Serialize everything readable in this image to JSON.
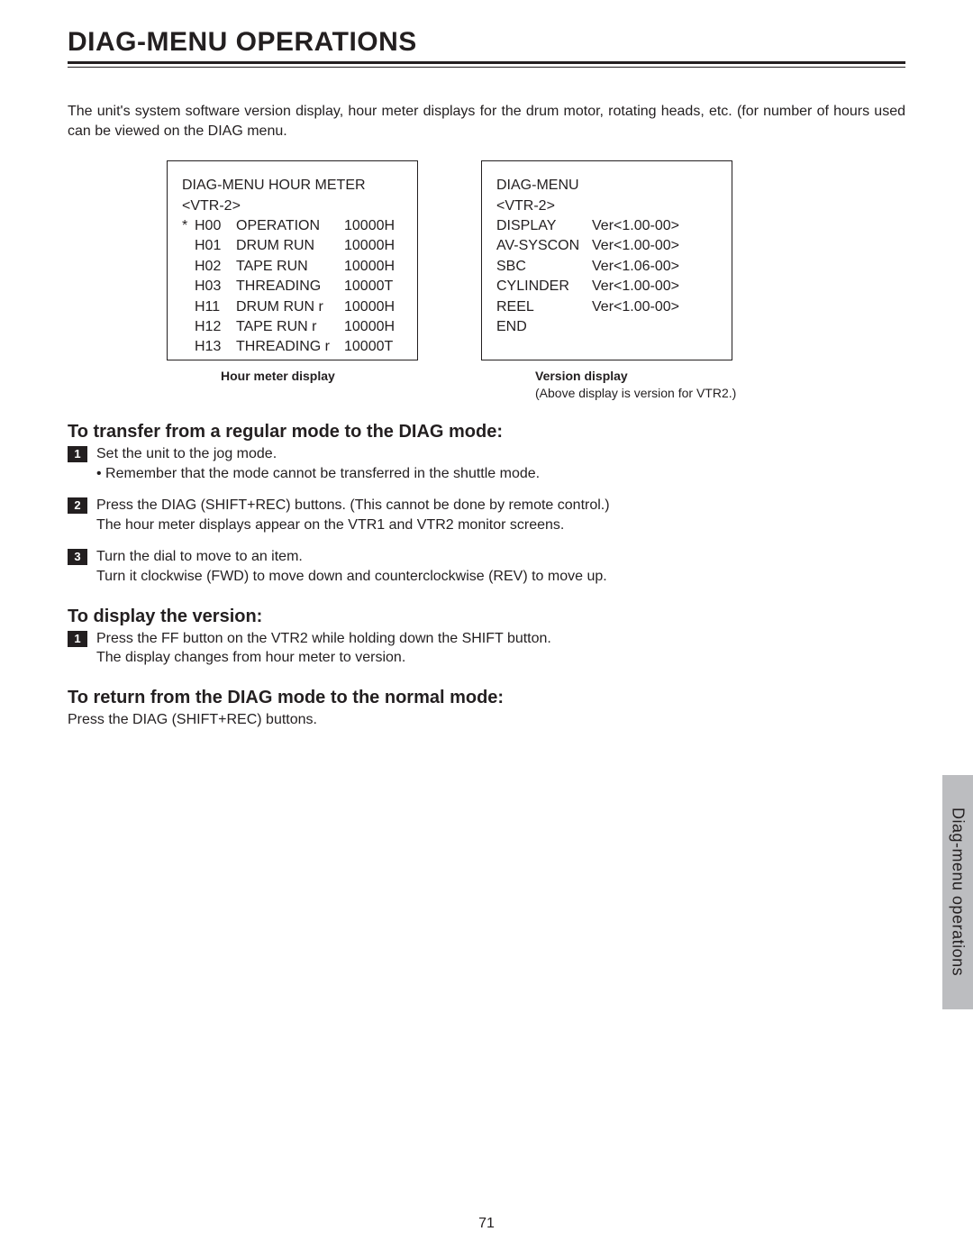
{
  "title": "DIAG-MENU OPERATIONS",
  "intro": "The unit's system software version display, hour meter displays for the drum motor, rotating heads, etc. (for number of hours used can be viewed on the DIAG menu.",
  "hour_meter": {
    "header1": "DIAG-MENU HOUR METER",
    "header2": "<VTR-2>",
    "rows": [
      {
        "mark": "*",
        "code": "H00",
        "name": "OPERATION",
        "val": "10000H"
      },
      {
        "mark": "",
        "code": "H01",
        "name": "DRUM RUN",
        "val": "10000H"
      },
      {
        "mark": "",
        "code": "H02",
        "name": "TAPE RUN",
        "val": "10000H"
      },
      {
        "mark": "",
        "code": "H03",
        "name": "THREADING",
        "val": "10000T"
      },
      {
        "mark": "",
        "code": "H11",
        "name": "DRUM RUN r",
        "val": "10000H"
      },
      {
        "mark": "",
        "code": "H12",
        "name": "TAPE RUN r",
        "val": "10000H"
      },
      {
        "mark": "",
        "code": "H13",
        "name": "THREADING r",
        "val": "10000T"
      }
    ],
    "caption_bold": "Hour meter display"
  },
  "version": {
    "header1": "DIAG-MENU",
    "header2": "<VTR-2>",
    "rows": [
      {
        "name": "DISPLAY",
        "val": "Ver<1.00-00>"
      },
      {
        "name": "AV-SYSCON",
        "val": "Ver<1.00-00>"
      },
      {
        "name": "SBC",
        "val": "Ver<1.06-00>"
      },
      {
        "name": "CYLINDER",
        "val": "Ver<1.00-00>"
      },
      {
        "name": "REEL",
        "val": "Ver<1.00-00>"
      },
      {
        "name": "END",
        "val": ""
      }
    ],
    "caption_bold": "Version display",
    "caption_note": "(Above display is version for VTR2.)"
  },
  "sections": {
    "s1": {
      "heading": "To transfer from a regular mode to the DIAG mode:",
      "steps": [
        {
          "num": "1",
          "lines": [
            "Set the unit to the jog mode.",
            "• Remember that the mode cannot be transferred in the shuttle mode."
          ]
        },
        {
          "num": "2",
          "lines": [
            "Press the DIAG (SHIFT+REC) buttons. (This cannot be done by remote control.)",
            "The hour meter displays appear on the VTR1 and VTR2 monitor screens."
          ]
        },
        {
          "num": "3",
          "lines": [
            "Turn the dial to move to an item.",
            "Turn it clockwise (FWD) to move down and counterclockwise (REV) to move up."
          ]
        }
      ]
    },
    "s2": {
      "heading": "To display the version:",
      "steps": [
        {
          "num": "1",
          "lines": [
            "Press the FF button on the VTR2 while holding down the SHIFT button.",
            "The display changes from hour meter to version."
          ]
        }
      ]
    },
    "s3": {
      "heading": "To return from the DIAG mode to the normal mode:",
      "plain": "Press the DIAG (SHIFT+REC) buttons."
    }
  },
  "page_number": "71",
  "side_tab": "Diag-menu operations"
}
